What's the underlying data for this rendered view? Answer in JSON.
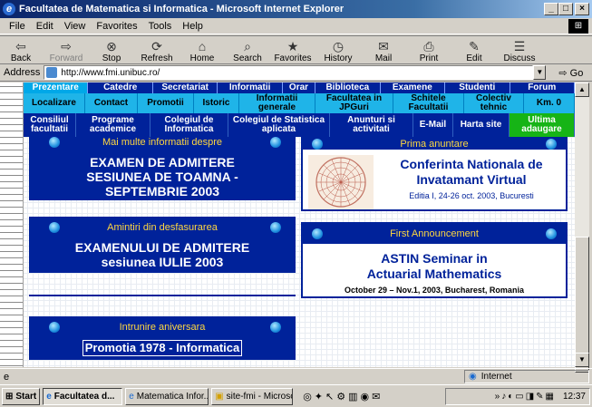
{
  "window": {
    "title": "Facultatea de Matematica si Informatica - Microsoft Internet Explorer",
    "min": "_",
    "max": "□",
    "close": "×"
  },
  "menu": [
    "File",
    "Edit",
    "View",
    "Favorites",
    "Tools",
    "Help"
  ],
  "toolbar": [
    {
      "label": "Back",
      "icon": "back-icon",
      "glyph": "⇦"
    },
    {
      "label": "Forward",
      "icon": "forward-icon",
      "glyph": "⇨"
    },
    {
      "label": "Stop",
      "icon": "stop-icon",
      "glyph": "⊗"
    },
    {
      "label": "Refresh",
      "icon": "refresh-icon",
      "glyph": "⟳"
    },
    {
      "label": "Home",
      "icon": "home-icon",
      "glyph": "⌂"
    },
    {
      "label": "Search",
      "icon": "search-icon",
      "glyph": "⌕"
    },
    {
      "label": "Favorites",
      "icon": "favorites-icon",
      "glyph": "★"
    },
    {
      "label": "History",
      "icon": "history-icon",
      "glyph": "◷"
    },
    {
      "label": "Mail",
      "icon": "mail-icon",
      "glyph": "✉"
    },
    {
      "label": "Print",
      "icon": "print-icon",
      "glyph": "⎙"
    },
    {
      "label": "Edit",
      "icon": "edit-icon",
      "glyph": "✎"
    },
    {
      "label": "Discuss",
      "icon": "discuss-icon",
      "glyph": "☰"
    }
  ],
  "address": {
    "label": "Address",
    "url": "http://www.fmi.unibuc.ro/",
    "go": "Go"
  },
  "nav": {
    "row1": [
      "Prezentare",
      "Catedre",
      "Secretariat",
      "Informatii",
      "Orar",
      "Biblioteca",
      "Examene",
      "Studenti",
      "Forum"
    ],
    "row2": [
      "Localizare",
      "Contact",
      "Promotii",
      "Istoric",
      "Informatii generale",
      "Facultatea in JPGuri",
      "Schitele Facultatii",
      "Colectiv tehnic",
      "Km. 0"
    ],
    "row3": [
      "Consiliul facultatii",
      "Programe academice",
      "Colegiul de Informatica",
      "Colegiul de Statistica aplicata",
      "Anunturi si activitati",
      "E-Mail",
      "Harta site",
      "Ultima adaugare"
    ]
  },
  "panels": {
    "admitere": {
      "header": "Mai multe informatii despre",
      "line1": "EXAMEN DE ADMITERE",
      "line2": "SESIUNEA DE TOAMNA -",
      "line3": "SEPTEMBRIE 2003"
    },
    "amintiri": {
      "header": "Amintiri din desfasurarea",
      "line1": "EXAMENULUI DE ADMITERE",
      "line2": "sesiunea IULIE 2003"
    },
    "intrunire": {
      "header": "Intrunire aniversara",
      "line1": "Promotia 1978 - Informatica"
    },
    "conferinta": {
      "header": "Prima anuntare",
      "line1": "Conferinta Nationala de",
      "line2": "Invatamant Virtual",
      "line3": "Editia I, 24-26 oct. 2003, Bucuresti"
    },
    "astin": {
      "header": "First Announcement",
      "line1": "ASTIN Seminar in",
      "line2": "Actuarial Mathematics",
      "line3": "October 29 – Nov.1, 2003, Bucharest, Romania"
    }
  },
  "status": {
    "zone": "Internet"
  },
  "taskbar": {
    "start": "Start",
    "buttons": [
      "Facultatea d...",
      "Matematica Infor...",
      "site-fmi - Microso..."
    ],
    "clock": "12:37"
  }
}
